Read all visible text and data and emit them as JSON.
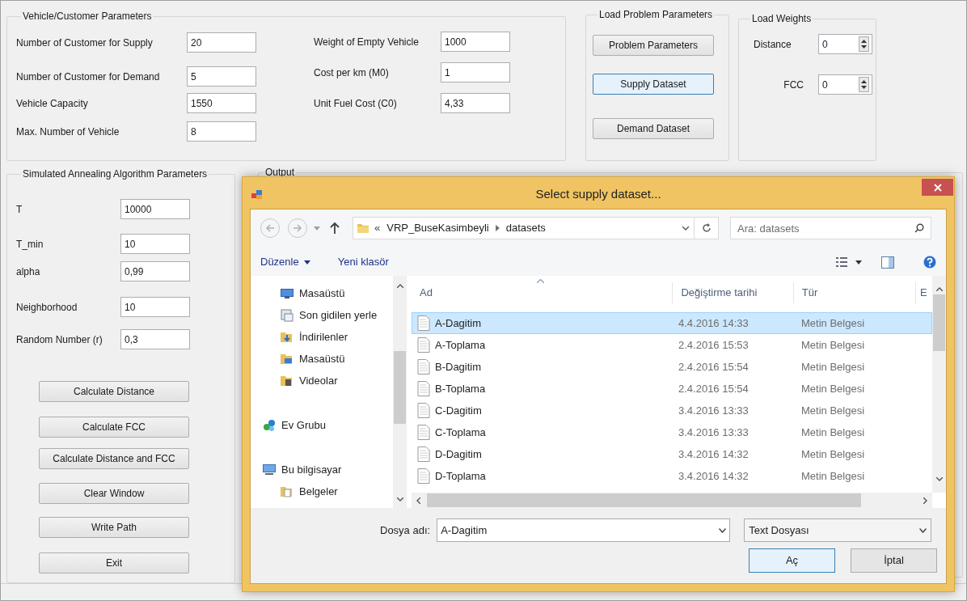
{
  "main_form": {
    "vehicle_customer_parameters": {
      "title": "Vehicle/Customer Parameters",
      "left_fields": [
        {
          "label": "Number of Customer for Supply",
          "value": "20"
        },
        {
          "label": "Number of Customer for Demand",
          "value": "5"
        },
        {
          "label": "Vehicle Capacity",
          "value": "1550"
        },
        {
          "label": "Max. Number of Vehicle",
          "value": "8"
        }
      ],
      "right_fields": [
        {
          "label": "Weight of Empty Vehicle",
          "value": "1000"
        },
        {
          "label": "Cost per km (M0)",
          "value": "1"
        },
        {
          "label": "Unit Fuel Cost (C0)",
          "value": "4,33"
        }
      ]
    },
    "load_problem_parameters": {
      "title": "Load Problem Parameters",
      "buttons": [
        {
          "label": "Problem Parameters",
          "focused": false
        },
        {
          "label": "Supply Dataset",
          "focused": true
        },
        {
          "label": "Demand Dataset",
          "focused": false
        }
      ]
    },
    "load_weights": {
      "title": "Load Weights",
      "fields": [
        {
          "label": "Distance",
          "value": "0"
        },
        {
          "label": "FCC",
          "value": "0"
        }
      ]
    },
    "simulated_annealing_parameters": {
      "title": "Simulated Annealing Algorithm Parameters",
      "fields": [
        {
          "label": "T",
          "value": "10000"
        },
        {
          "label": "T_min",
          "value": "10"
        },
        {
          "label": "alpha",
          "value": "0,99"
        },
        {
          "label": "Neighborhood",
          "value": "10"
        },
        {
          "label": "Random Number (r)",
          "value": "0,3"
        }
      ],
      "buttons": [
        {
          "label": "Calculate Distance"
        },
        {
          "label": "Calculate FCC"
        },
        {
          "label": "Calculate Distance and FCC"
        },
        {
          "label": "Clear Window"
        },
        {
          "label": "Write Path"
        },
        {
          "label": "Exit"
        }
      ]
    },
    "output": {
      "title": "Output"
    }
  },
  "dialog": {
    "title": "Select supply dataset...",
    "address": {
      "prefix": "«",
      "path": [
        "VRP_BuseKasimbeyli",
        "datasets"
      ]
    },
    "search": {
      "placeholder": "Ara: datasets"
    },
    "toolbar": {
      "organize": "Düzenle",
      "new_folder": "Yeni klasör"
    },
    "nav": [
      {
        "label": "Masaüstü",
        "kind": "desktop"
      },
      {
        "label": "Son gidilen yerle",
        "kind": "recent"
      },
      {
        "label": "İndirilenler",
        "kind": "downloads"
      },
      {
        "label": "Masaüstü",
        "kind": "desktop_folder"
      },
      {
        "label": "Videolar",
        "kind": "videos"
      },
      {
        "label": "Ev Grubu",
        "kind": "homegroup"
      },
      {
        "label": "Bu bilgisayar",
        "kind": "computer",
        "children": [
          {
            "label": "Belgeler",
            "kind": "documents"
          }
        ]
      }
    ],
    "columns": [
      "Ad",
      "Değiştirme tarihi",
      "Tür",
      "E"
    ],
    "rows": [
      {
        "name": "A-Dagitim",
        "date": "4.4.2016 14:33",
        "type": "Metin Belgesi",
        "selected": true
      },
      {
        "name": "A-Toplama",
        "date": "2.4.2016 15:53",
        "type": "Metin Belgesi",
        "selected": false
      },
      {
        "name": "B-Dagitim",
        "date": "2.4.2016 15:54",
        "type": "Metin Belgesi",
        "selected": false
      },
      {
        "name": "B-Toplama",
        "date": "2.4.2016 15:54",
        "type": "Metin Belgesi",
        "selected": false
      },
      {
        "name": "C-Dagitim",
        "date": "3.4.2016 13:33",
        "type": "Metin Belgesi",
        "selected": false
      },
      {
        "name": "C-Toplama",
        "date": "3.4.2016 13:33",
        "type": "Metin Belgesi",
        "selected": false
      },
      {
        "name": "D-Dagitim",
        "date": "3.4.2016 14:32",
        "type": "Metin Belgesi",
        "selected": false
      },
      {
        "name": "D-Toplama",
        "date": "3.4.2016 14:32",
        "type": "Metin Belgesi",
        "selected": false
      }
    ],
    "file_name": {
      "label": "Dosya adı:",
      "value": "A-Dagitim"
    },
    "file_type": "Text Dosyası",
    "buttons": [
      {
        "label": "Aç",
        "default": true
      },
      {
        "label": "İptal",
        "default": false
      }
    ]
  }
}
